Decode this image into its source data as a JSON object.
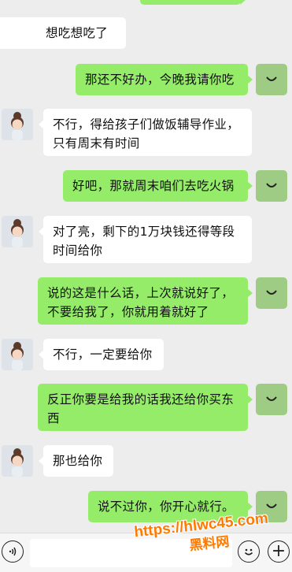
{
  "messages": [
    {
      "side": "left",
      "text": "想吃想吃了"
    },
    {
      "side": "right",
      "text": "那还不好办，今晚我请你吃"
    },
    {
      "side": "left",
      "text": "不行，得给孩子们做饭辅导作业，\n只有周末有时间"
    },
    {
      "side": "right",
      "text": "好吧，那就周末咱们去吃火锅"
    },
    {
      "side": "left",
      "text": "对了亮，剩下的1万块钱还得等段\n时间给你"
    },
    {
      "side": "right",
      "text": "说的这是什么话，上次就说好了，\n不要给我了，你就用着就好了"
    },
    {
      "side": "left",
      "text": "不行，一定要给你"
    },
    {
      "side": "right",
      "text": "反正你要是给我的话我还给你买东\n西"
    },
    {
      "side": "left",
      "text": "那也给你"
    },
    {
      "side": "right",
      "text": "说不过你，你开心就行。"
    }
  ],
  "input_bar": {
    "icons": [
      "voice-icon",
      "emoji-icon",
      "plus-icon"
    ],
    "plus_glyph": "+"
  },
  "watermark": {
    "url": "https://hlwc45.com",
    "cn": "黑料网"
  },
  "colors": {
    "my_bubble": "#95ec69",
    "their_bubble": "#ffffff",
    "background": "#ededed",
    "watermark": "#ff7a00"
  }
}
